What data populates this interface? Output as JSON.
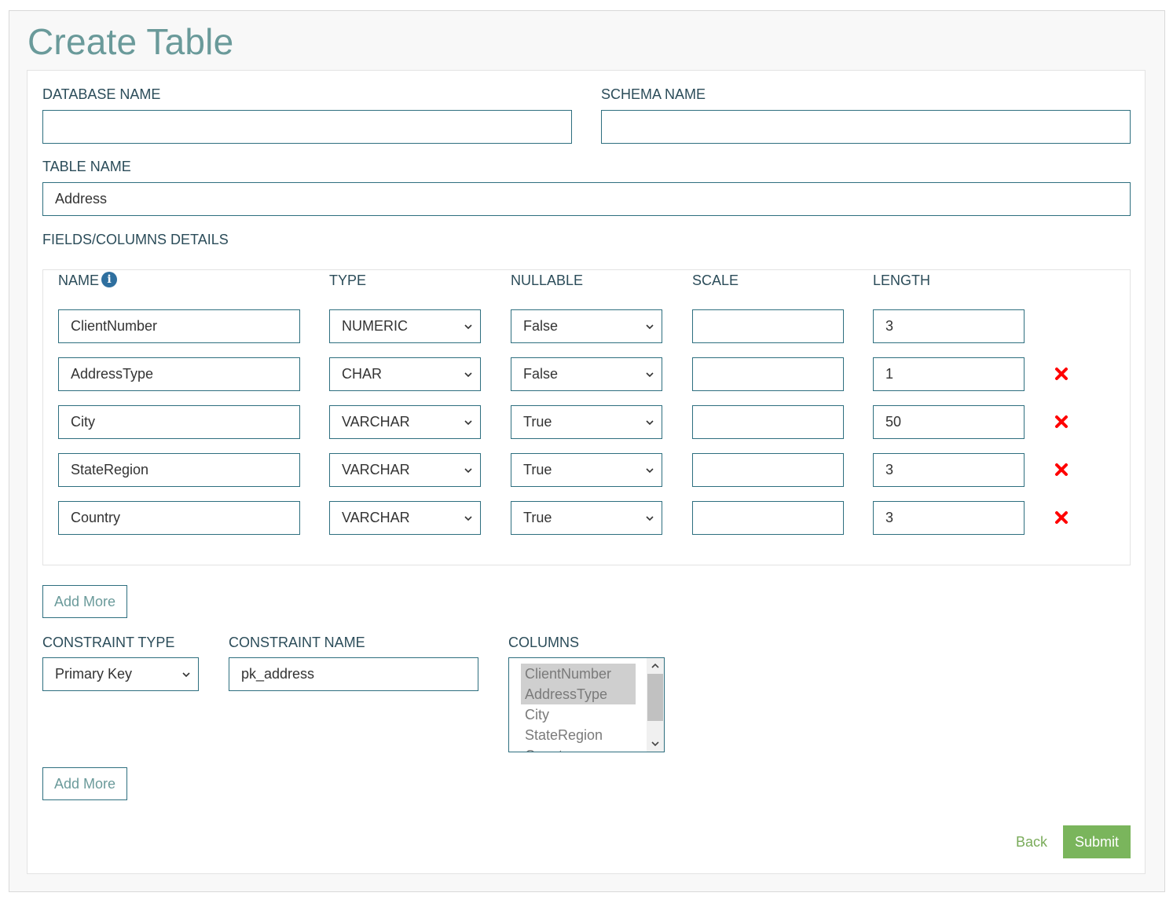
{
  "page": {
    "title": "Create Table"
  },
  "form": {
    "database_name": {
      "label": "DATABASE NAME",
      "value": ""
    },
    "schema_name": {
      "label": "SCHEMA NAME",
      "value": ""
    },
    "table_name": {
      "label": "TABLE NAME",
      "value": "Address"
    },
    "fields_section_label": "FIELDS/COLUMNS DETAILS"
  },
  "fields": {
    "headers": {
      "name": "NAME",
      "type": "TYPE",
      "nullable": "NULLABLE",
      "scale": "SCALE",
      "length": "LENGTH"
    },
    "rows": [
      {
        "name": "ClientNumber",
        "type": "NUMERIC",
        "nullable": "False",
        "scale": "",
        "length": "3",
        "deletable": false
      },
      {
        "name": "AddressType",
        "type": "CHAR",
        "nullable": "False",
        "scale": "",
        "length": "1",
        "deletable": true
      },
      {
        "name": "City",
        "type": "VARCHAR",
        "nullable": "True",
        "scale": "",
        "length": "50",
        "deletable": true
      },
      {
        "name": "StateRegion",
        "type": "VARCHAR",
        "nullable": "True",
        "scale": "",
        "length": "3",
        "deletable": true
      },
      {
        "name": "Country",
        "type": "VARCHAR",
        "nullable": "True",
        "scale": "",
        "length": "3",
        "deletable": true
      }
    ],
    "add_more_label": "Add More"
  },
  "constraint": {
    "type_label": "CONSTRAINT TYPE",
    "type_value": "Primary Key",
    "name_label": "CONSTRAINT NAME",
    "name_value": "pk_address",
    "columns_label": "COLUMNS",
    "columns_options": [
      {
        "label": "ClientNumber",
        "selected": true
      },
      {
        "label": "AddressType",
        "selected": true
      },
      {
        "label": "City",
        "selected": false
      },
      {
        "label": "StateRegion",
        "selected": false
      },
      {
        "label": "Country",
        "selected": false
      }
    ],
    "add_more_label": "Add More"
  },
  "actions": {
    "back_label": "Back",
    "submit_label": "Submit"
  },
  "colors": {
    "accent": "#2e6f7f",
    "title": "#6a9a9a",
    "submit": "#7ab55c",
    "delete": "#ff0000"
  },
  "icons": {
    "info": "info-icon",
    "delete": "delete-x-icon",
    "dropdown": "chevron-down-icon"
  }
}
